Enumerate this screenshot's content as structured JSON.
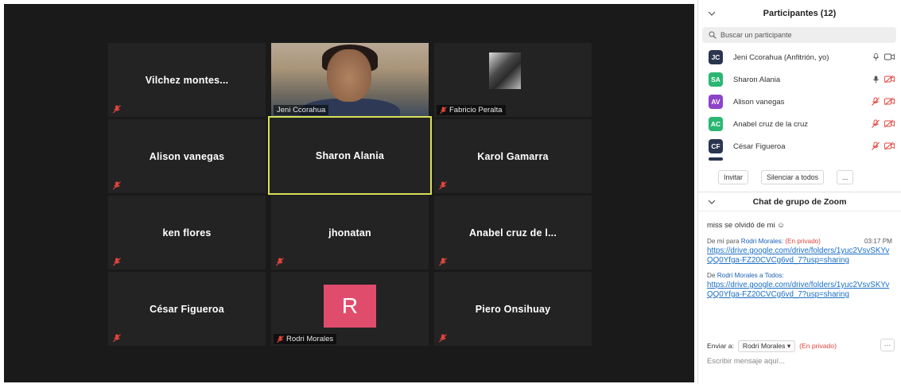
{
  "meeting": {
    "tiles": [
      {
        "name": "Vilchez  montes...",
        "type": "name",
        "mic_off": true
      },
      {
        "name": "Jeni Ccorahua",
        "type": "video",
        "mic_off": false
      },
      {
        "name": "Fabricio Peralta",
        "type": "image",
        "mic_off": true
      },
      {
        "name": "Alison vanegas",
        "type": "name",
        "mic_off": true
      },
      {
        "name": "Sharon Alania",
        "type": "name",
        "mic_off": false,
        "active_speaker": true
      },
      {
        "name": "Karol  Gamarra",
        "type": "name",
        "mic_off": true
      },
      {
        "name": "ken flores",
        "type": "name",
        "mic_off": true
      },
      {
        "name": "jhonatan",
        "type": "name",
        "mic_off": true
      },
      {
        "name": "Anabel cruz de l...",
        "type": "name",
        "mic_off": true
      },
      {
        "name": "César Figueroa",
        "type": "name",
        "mic_off": true
      },
      {
        "name": "Rodri Morales",
        "type": "initial",
        "initial": "R",
        "mic_off": true
      },
      {
        "name": "Piero Onsihuay",
        "type": "name",
        "mic_off": true
      }
    ]
  },
  "participants": {
    "title": "Participantes (12)",
    "search_placeholder": "Buscar un participante",
    "list": [
      {
        "initials": "JC",
        "name": "Jeni Ccorahua (Anfitrión, yo)",
        "color": "#2a3550",
        "mic": "on",
        "video": "on"
      },
      {
        "initials": "SA",
        "name": "Sharon Alania",
        "color": "#2bb673",
        "mic": "speaking",
        "video": "off"
      },
      {
        "initials": "AV",
        "name": "Alison vanegas",
        "color": "#8e44c9",
        "mic": "off",
        "video": "off"
      },
      {
        "initials": "AC",
        "name": "Anabel cruz de la cruz",
        "color": "#2bb673",
        "mic": "off",
        "video": "off"
      },
      {
        "initials": "CF",
        "name": "César Figueroa",
        "color": "#2a3550",
        "mic": "off",
        "video": "off"
      }
    ],
    "invite_label": "Invitar",
    "mute_all_label": "Silenciar a todos",
    "more_label": "..."
  },
  "chat": {
    "title": "Chat de grupo de Zoom",
    "first_message": "miss se olvidó de mi ☺",
    "messages": [
      {
        "from": "De mí para",
        "to": "Rodri Morales:",
        "private": "(En privado)",
        "time": "03:17 PM",
        "link": "https://drive.google.com/drive/folders/1yuc2VsvSKYvQQ0Yfga-FZ20CVCg6vd_7?usp=sharing"
      },
      {
        "from": "De",
        "to": "Rodri Morales a Todos:",
        "private": "",
        "time": "",
        "link": "https://drive.google.com/drive/folders/1yuc2VsvSKYvQQ0Yfga-FZ20CVCg6vd_7?usp=sharing"
      }
    ],
    "send_to_label": "Enviar a:",
    "send_to_value": "Rodri Morales",
    "send_to_private": "(En privado)",
    "input_placeholder": "Escribir mensaje aquí...",
    "more_label": "···"
  },
  "colors": {
    "stage_bg": "#1a1a1a",
    "tile_bg": "#232323",
    "active_border": "#d8e05a",
    "mic_off_red": "#e0443c",
    "link_blue": "#1a6fc5"
  }
}
